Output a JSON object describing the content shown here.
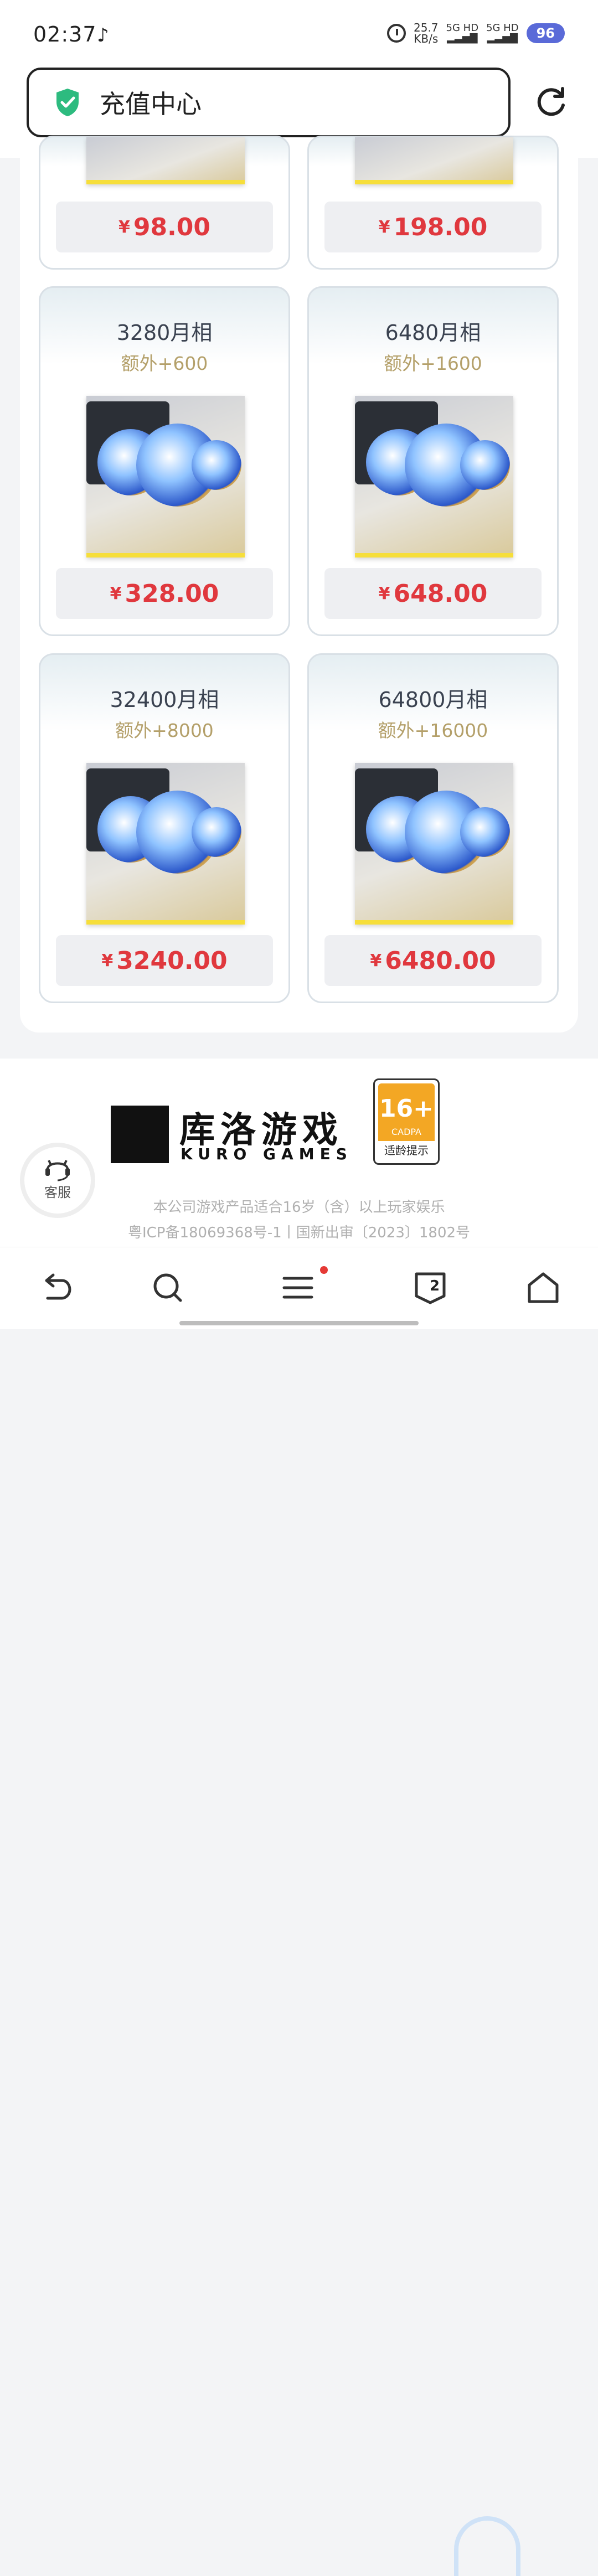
{
  "status_bar": {
    "time": "02:37",
    "app_icon": "tiktok-icon",
    "speed_value": "25.7",
    "speed_unit": "KB/s",
    "sim1": "5G HD",
    "sim2": "5G HD",
    "battery": "96"
  },
  "browser": {
    "title": "充值中心",
    "secure_icon": "shield-check-icon",
    "refresh_icon": "refresh-icon"
  },
  "products_top": [
    {
      "price_symbol": "¥",
      "price": "98.00"
    },
    {
      "price_symbol": "¥",
      "price": "198.00"
    }
  ],
  "products": [
    {
      "name": "3280月相",
      "bonus": "额外+600",
      "price_symbol": "¥",
      "price": "328.00"
    },
    {
      "name": "6480月相",
      "bonus": "额外+1600",
      "price_symbol": "¥",
      "price": "648.00"
    },
    {
      "name": "32400月相",
      "bonus": "额外+8000",
      "price_symbol": "¥",
      "price": "3240.00"
    },
    {
      "name": "64800月相",
      "bonus": "额外+16000",
      "price_symbol": "¥",
      "price": "6480.00"
    }
  ],
  "footer": {
    "brand_cn": "库洛游戏",
    "brand_en": "KURO GAMES",
    "age_rating": "16+",
    "age_org": "CADPA",
    "age_tip": "适龄提示",
    "customer_service": "客服",
    "notice": "本公司游戏产品适合16岁（含）以上玩家娱乐",
    "license": "粤ICP备18069368号-1丨国新出审〔2023〕1802号"
  },
  "nav": {
    "tab_count": "2",
    "back_icon": "back-arrow-icon",
    "search_icon": "search-icon",
    "menu_icon": "menu-icon",
    "tabs_icon": "tabs-icon",
    "home_icon": "home-icon"
  },
  "colors": {
    "price_red": "#e0383e",
    "bonus_gold": "#b4a06a",
    "battery_blue": "#5a6ad8",
    "shield_green": "#2dbb7f"
  }
}
